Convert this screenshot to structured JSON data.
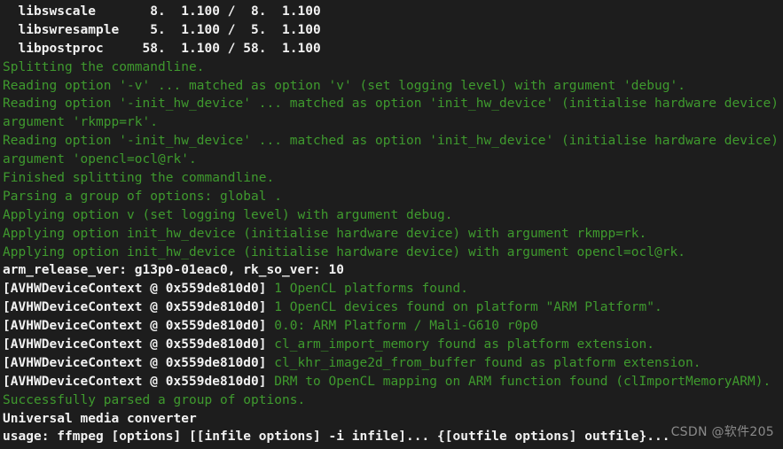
{
  "terminal": {
    "background_color": "#1d1d1d",
    "text_color_green": "#3f9a2e",
    "text_color_white": "#f2f2f2",
    "lines": [
      {
        "type": "plain",
        "style": "whitebold",
        "text": "  libswscale       8.  1.100 /  8.  1.100"
      },
      {
        "type": "plain",
        "style": "whitebold",
        "text": "  libswresample    5.  1.100 /  5.  1.100"
      },
      {
        "type": "plain",
        "style": "whitebold",
        "text": "  libpostproc     58.  1.100 / 58.  1.100"
      },
      {
        "type": "plain",
        "style": "green",
        "text": "Splitting the commandline."
      },
      {
        "type": "plain",
        "style": "green",
        "text": "Reading option '-v' ... matched as option 'v' (set logging level) with argument 'debug'."
      },
      {
        "type": "plain",
        "style": "green",
        "text": "Reading option '-init_hw_device' ... matched as option 'init_hw_device' (initialise hardware device) with"
      },
      {
        "type": "plain",
        "style": "green",
        "text": "argument 'rkmpp=rk'."
      },
      {
        "type": "plain",
        "style": "green",
        "text": "Reading option '-init_hw_device' ... matched as option 'init_hw_device' (initialise hardware device) with"
      },
      {
        "type": "plain",
        "style": "green",
        "text": "argument 'opencl=ocl@rk'."
      },
      {
        "type": "plain",
        "style": "green",
        "text": "Finished splitting the commandline."
      },
      {
        "type": "plain",
        "style": "green",
        "text": "Parsing a group of options: global ."
      },
      {
        "type": "plain",
        "style": "green",
        "text": "Applying option v (set logging level) with argument debug."
      },
      {
        "type": "plain",
        "style": "green",
        "text": "Applying option init_hw_device (initialise hardware device) with argument rkmpp=rk."
      },
      {
        "type": "plain",
        "style": "green",
        "text": "Applying option init_hw_device (initialise hardware device) with argument opencl=ocl@rk."
      },
      {
        "type": "plain",
        "style": "whitebold",
        "text": "arm_release_ver: g13p0-01eac0, rk_so_ver: 10"
      },
      {
        "type": "log",
        "prefix": "[AVHWDeviceContext @ 0x559de810d0] ",
        "message": "1 OpenCL platforms found."
      },
      {
        "type": "log",
        "prefix": "[AVHWDeviceContext @ 0x559de810d0] ",
        "message": "1 OpenCL devices found on platform \"ARM Platform\"."
      },
      {
        "type": "log",
        "prefix": "[AVHWDeviceContext @ 0x559de810d0] ",
        "message": "0.0: ARM Platform / Mali-G610 r0p0"
      },
      {
        "type": "log",
        "prefix": "[AVHWDeviceContext @ 0x559de810d0] ",
        "message": "cl_arm_import_memory found as platform extension."
      },
      {
        "type": "log",
        "prefix": "[AVHWDeviceContext @ 0x559de810d0] ",
        "message": "cl_khr_image2d_from_buffer found as platform extension."
      },
      {
        "type": "log",
        "prefix": "[AVHWDeviceContext @ 0x559de810d0] ",
        "message": "DRM to OpenCL mapping on ARM function found (clImportMemoryARM)."
      },
      {
        "type": "plain",
        "style": "green",
        "text": "Successfully parsed a group of options."
      },
      {
        "type": "plain",
        "style": "whitebold",
        "text": "Universal media converter"
      },
      {
        "type": "plain",
        "style": "whitebold",
        "text": "usage: ffmpeg [options] [[infile options] -i infile]... {[outfile options] outfile}..."
      }
    ]
  },
  "watermark": {
    "text": "CSDN @软件205"
  }
}
